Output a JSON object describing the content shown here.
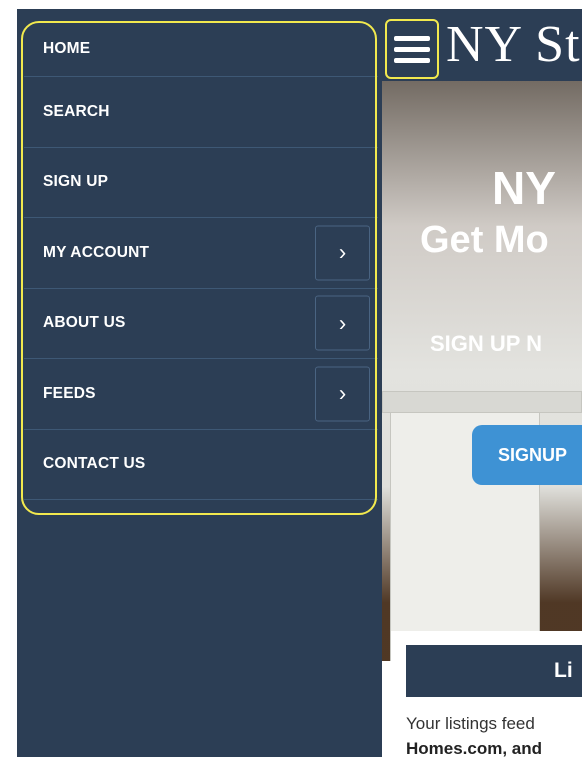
{
  "menu": {
    "items": [
      {
        "label": "HOME",
        "has_submenu": false
      },
      {
        "label": "SEARCH",
        "has_submenu": false
      },
      {
        "label": "SIGN UP",
        "has_submenu": false
      },
      {
        "label": "MY ACCOUNT",
        "has_submenu": true
      },
      {
        "label": "ABOUT US",
        "has_submenu": true
      },
      {
        "label": "FEEDS",
        "has_submenu": true
      },
      {
        "label": "CONTACT US",
        "has_submenu": false
      }
    ],
    "chevron_glyph": "›"
  },
  "header": {
    "brand": "NY St"
  },
  "hero": {
    "line1": "NY",
    "line2": "Get Mo",
    "line3": "SIGN UP N",
    "button_label": "SIGNUP"
  },
  "listings": {
    "heading": "Li",
    "text_line1": "Your listings feed",
    "text_line2": "Homes.com, and"
  },
  "colors": {
    "menu_bg": "#2c3e55",
    "highlight": "#f2e94e",
    "button": "#3e92d4"
  },
  "icons": {
    "menu": "hamburger-icon",
    "submenu": "chevron-right-icon"
  }
}
